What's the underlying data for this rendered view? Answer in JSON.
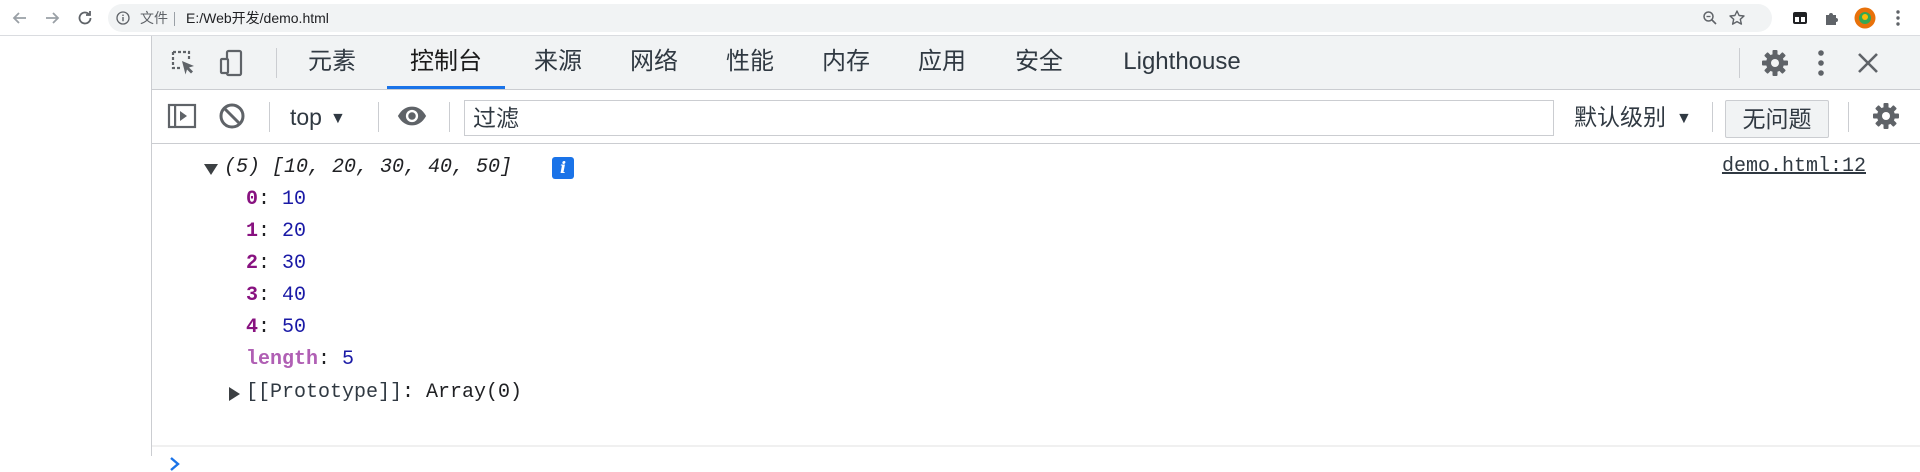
{
  "browser": {
    "scheme_label": "文件",
    "url": "E:/Web开发/demo.html"
  },
  "devtools": {
    "tabs": [
      {
        "label": "元素"
      },
      {
        "label": "控制台",
        "active": true
      },
      {
        "label": "来源"
      },
      {
        "label": "网络"
      },
      {
        "label": "性能"
      },
      {
        "label": "内存"
      },
      {
        "label": "应用"
      },
      {
        "label": "安全"
      },
      {
        "label": "Lighthouse"
      }
    ],
    "console_toolbar": {
      "context": "top",
      "filter_placeholder": "过滤",
      "levels": "默认级别",
      "issues": "无问题"
    },
    "console": {
      "summary": "(5) [10, 20, 30, 40, 50]",
      "source": "demo.html:12",
      "entries": [
        {
          "key": "0",
          "value": "10"
        },
        {
          "key": "1",
          "value": "20"
        },
        {
          "key": "2",
          "value": "30"
        },
        {
          "key": "3",
          "value": "40"
        },
        {
          "key": "4",
          "value": "50"
        }
      ],
      "length_key": "length",
      "length_value": "5",
      "prototype_key": "[[Prototype]]",
      "prototype_value": "Array(0)"
    }
  },
  "colors": {
    "accent": "#1a73e8",
    "key": "#881280",
    "number": "#1a1aa6"
  }
}
